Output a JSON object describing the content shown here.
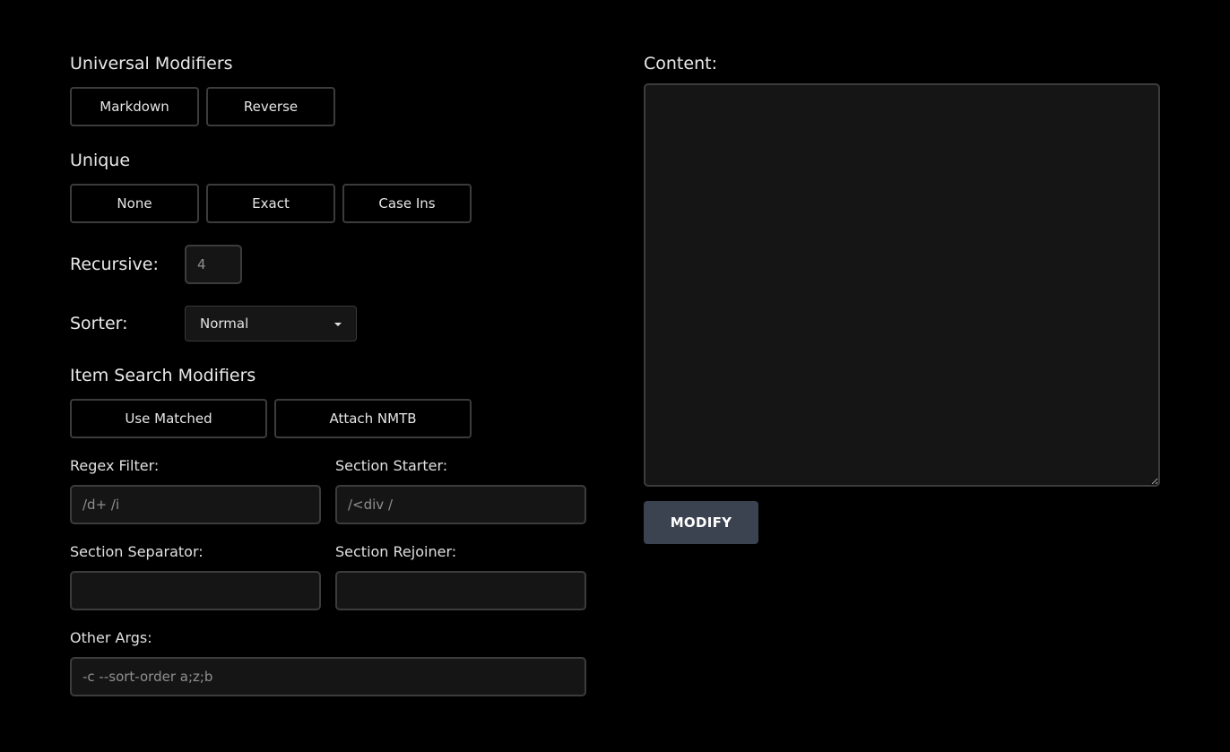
{
  "universal_modifiers": {
    "heading": "Universal Modifiers",
    "buttons": [
      "Markdown",
      "Reverse"
    ]
  },
  "unique": {
    "heading": "Unique",
    "buttons": [
      "None",
      "Exact",
      "Case Ins"
    ]
  },
  "recursive": {
    "label": "Recursive:",
    "placeholder": "4"
  },
  "sorter": {
    "label": "Sorter:",
    "selected": "Normal",
    "caret_icon": "caret-down-icon"
  },
  "item_search_modifiers": {
    "heading": "Item Search Modifiers",
    "buttons": [
      "Use Matched",
      "Attach NMTB"
    ]
  },
  "regex_filter": {
    "label": "Regex Filter:",
    "placeholder": "/d+ /i"
  },
  "section_starter": {
    "label": "Section Starter:",
    "placeholder": "/<div /"
  },
  "section_separator": {
    "label": "Section Separator:",
    "placeholder": ""
  },
  "section_rejoiner": {
    "label": "Section Rejoiner:",
    "placeholder": ""
  },
  "other_args": {
    "label": "Other Args:",
    "placeholder": "-c --sort-order a;z;b"
  },
  "content": {
    "label": "Content:",
    "value": ""
  },
  "modify_button": {
    "label": "MODIFY"
  },
  "colors": {
    "background": "#000000",
    "button_border": "#3c3c3c",
    "input_background": "#151515",
    "primary_button": "#3b4250"
  }
}
